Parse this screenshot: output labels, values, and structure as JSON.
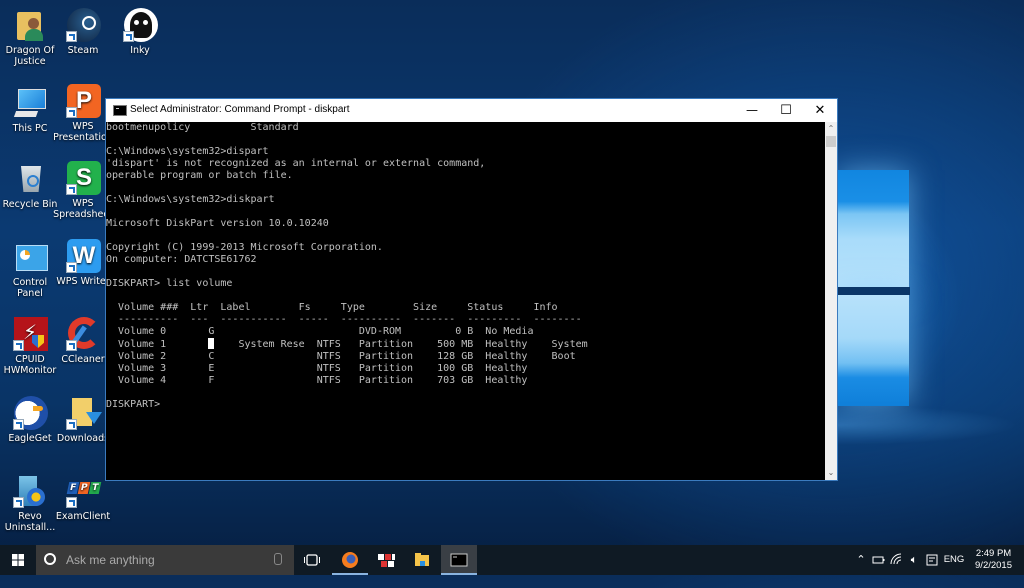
{
  "desktop": {
    "icons": [
      {
        "label": "Dragon Of Justice",
        "icon": "user-folder-icon"
      },
      {
        "label": "Steam",
        "icon": "steam-icon"
      },
      {
        "label": "Inky",
        "icon": "inky-icon"
      },
      {
        "label": "This PC",
        "icon": "computer-icon"
      },
      {
        "label": "WPS Presentation",
        "icon": "wps-presentation-icon"
      },
      {
        "label": "Recycle Bin",
        "icon": "recycle-bin-icon"
      },
      {
        "label": "WPS Spreadsheet",
        "icon": "wps-spreadsheet-icon"
      },
      {
        "label": "Control Panel",
        "icon": "control-panel-icon"
      },
      {
        "label": "WPS Writer",
        "icon": "wps-writer-icon"
      },
      {
        "label": "CPUID HWMonitor",
        "icon": "hwmonitor-icon"
      },
      {
        "label": "CCleaner",
        "icon": "ccleaner-icon"
      },
      {
        "label": "EagleGet",
        "icon": "eagleget-icon"
      },
      {
        "label": "Downloads",
        "icon": "downloads-folder-icon"
      },
      {
        "label": "Revo Uninstall...",
        "icon": "revo-uninstaller-icon"
      },
      {
        "label": "ExamClient",
        "icon": "fpt-examclient-icon"
      }
    ]
  },
  "window": {
    "title": "Select Administrator: Command Prompt - diskpart",
    "controls": {
      "minimize": "—",
      "maximize": "☐",
      "close": "✕"
    },
    "console_lines": [
      "bootmenupolicy          Standard",
      "",
      "C:\\Windows\\system32>dispart",
      "'dispart' is not recognized as an internal or external command,",
      "operable program or batch file.",
      "",
      "C:\\Windows\\system32>diskpart",
      "",
      "Microsoft DiskPart version 10.0.10240",
      "",
      "Copyright (C) 1999-2013 Microsoft Corporation.",
      "On computer: DATCTSE61762",
      "",
      "DISKPART> list volume",
      ""
    ],
    "volume_table": {
      "header": "  Volume ###  Ltr  Label        Fs     Type        Size     Status     Info",
      "separator": "  ----------  ---  -----------  -----  ----------  -------  ---------  --------",
      "rows": [
        {
          "volume": "Volume 0",
          "ltr": "G",
          "label": "",
          "fs": "",
          "type": "DVD-ROM",
          "size": "0 B",
          "status": "No Media",
          "info": ""
        },
        {
          "volume": "Volume 1",
          "ltr": "",
          "label": "System Rese",
          "fs": "NTFS",
          "type": "Partition",
          "size": "500 MB",
          "status": "Healthy",
          "info": "System"
        },
        {
          "volume": "Volume 2",
          "ltr": "C",
          "label": "",
          "fs": "NTFS",
          "type": "Partition",
          "size": "128 GB",
          "status": "Healthy",
          "info": "Boot"
        },
        {
          "volume": "Volume 3",
          "ltr": "E",
          "label": "",
          "fs": "NTFS",
          "type": "Partition",
          "size": "100 GB",
          "status": "Healthy",
          "info": ""
        },
        {
          "volume": "Volume 4",
          "ltr": "F",
          "label": "",
          "fs": "NTFS",
          "type": "Partition",
          "size": "703 GB",
          "status": "Healthy",
          "info": ""
        }
      ]
    },
    "prompt": "DISKPART>"
  },
  "taskbar": {
    "search_placeholder": "Ask me anything",
    "pinned": [
      {
        "name": "task-view",
        "icon": "task-view-icon"
      },
      {
        "name": "firefox",
        "icon": "firefox-icon"
      },
      {
        "name": "app-red",
        "icon": "app-grid-icon"
      },
      {
        "name": "file-explorer",
        "icon": "file-explorer-icon"
      },
      {
        "name": "command-prompt",
        "icon": "cmd-icon"
      }
    ],
    "tray": {
      "language": "ENG",
      "time": "2:49 PM",
      "date": "9/2/2015"
    }
  }
}
